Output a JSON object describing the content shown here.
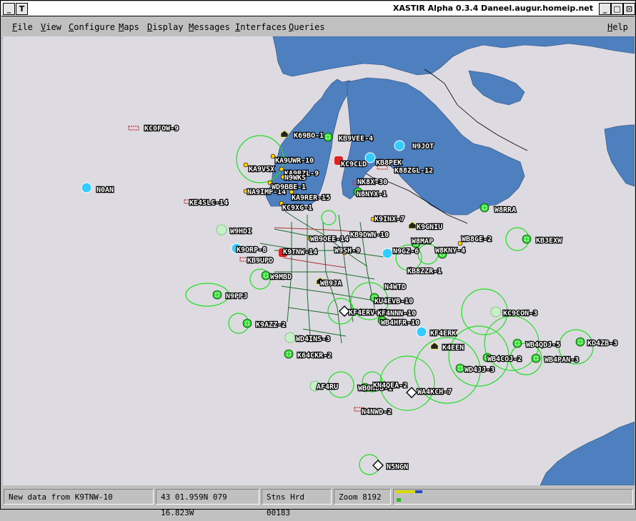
{
  "window": {
    "title": "XASTIR Alpha 0.3.4 Daneel.augur.homeip.net",
    "left_buttons": [
      "_",
      "T"
    ],
    "right_buttons": [
      "_",
      "□",
      "⊡"
    ]
  },
  "menu": [
    "File",
    "View",
    "Configure",
    "Maps",
    "Display",
    "Messages",
    "Interfaces",
    "Queries"
  ],
  "help": "Help",
  "status": {
    "message": "New data from K9TNW-10",
    "coords": "43 01.959N 079 16.823W",
    "stations": "Stns Hrd 00183",
    "zoom": "Zoom 8192"
  },
  "stations": [
    "KC0FOW-9",
    "K69BO-1",
    "KB9VEE-4",
    "N9JOT",
    "KA9VSX",
    "KA9UWR-10",
    "KC9CLD",
    "KB8PEK",
    "KA9RZL-9",
    "K88ZGL-12",
    "N0AN",
    "NA9IMP-14",
    "N9WKS",
    "WD9BBE-1",
    "KA9RER-15",
    "NK8X-30",
    "N8NYX-1",
    "KE4SLC-14",
    "KC9XG-1",
    "W8RRA",
    "W9HDI",
    "K9INX-7",
    "K9GNIU",
    "KB9DWN-10",
    "WB9OEE-14",
    "K9ORP-8",
    "K9TNW-14",
    "W8MAP",
    "WB8GE-2",
    "KB9UPD",
    "W9SH-9",
    "N9GZ-6",
    "KB8ZZR-1",
    "W8KNY-4",
    "KB3EXW",
    "W9MBD",
    "WB9JA",
    "N4WTD",
    "N9PPJ",
    "KU4EVB-10",
    "KF4ERV-10",
    "KF4NNN-10",
    "WB4HFR-10",
    "K9AZZ-2",
    "KC9CON-3",
    "KF4ERK",
    "KD4ZB-3",
    "WD4INS-3",
    "WB4QDJ-5",
    "K4EEN",
    "WB4COJ-2",
    "WB4PAN-3",
    "K64CKR-2",
    "WD4JJ-3",
    "AF4RU",
    "WB0NDO-1",
    "KN4QEA-2",
    "WA4KCH-7",
    "N4NWD-2",
    "N5NGN"
  ]
}
